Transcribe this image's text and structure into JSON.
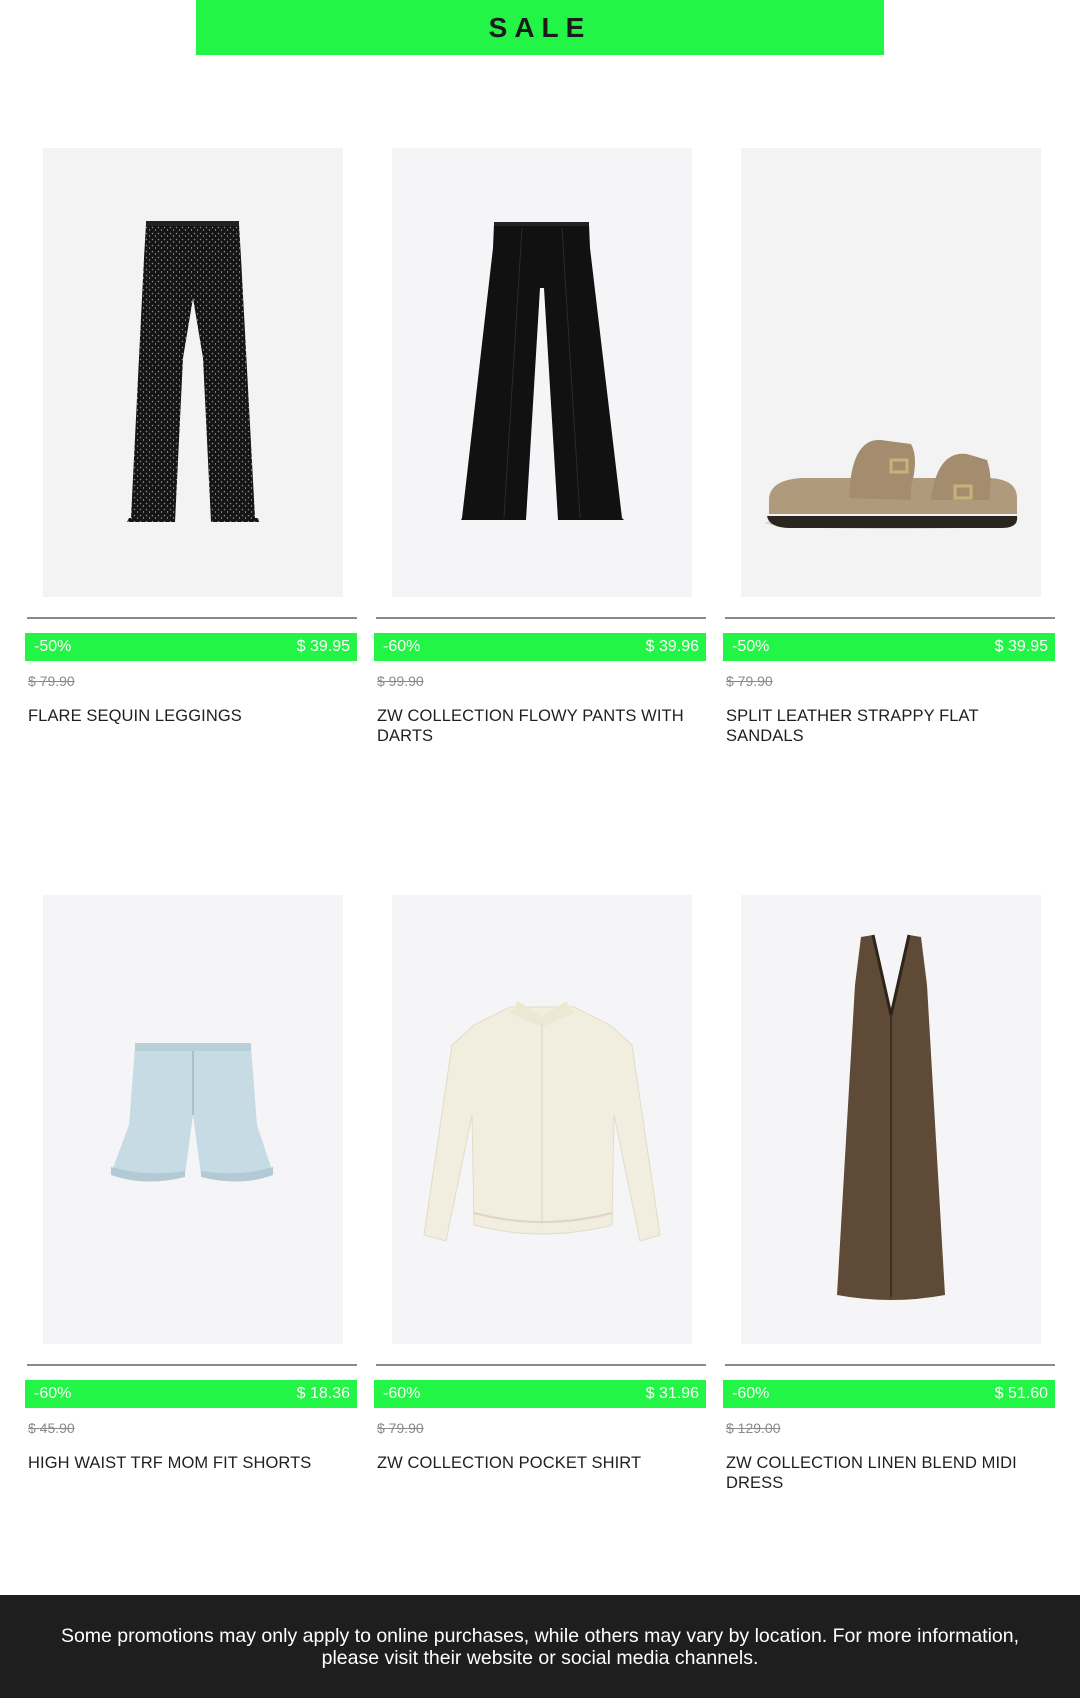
{
  "banner": {
    "title": "SALE"
  },
  "colors": {
    "accent": "#22f545",
    "footer_bg": "#1e1e1e"
  },
  "products": [
    {
      "discount": "-50%",
      "price": "$ 39.95",
      "original_price": "$ 79.90",
      "name": "FLARE SEQUIN LEGGINGS",
      "image_icon": "sequin-leggings-image"
    },
    {
      "discount": "-60%",
      "price": "$ 39.96",
      "original_price": "$ 99.90",
      "name": "ZW COLLECTION FLOWY PANTS WITH DARTS",
      "image_icon": "flowy-pants-image"
    },
    {
      "discount": "-50%",
      "price": "$ 39.95",
      "original_price": "$ 79.90",
      "name": "SPLIT LEATHER STRAPPY FLAT SANDALS",
      "image_icon": "sandals-image"
    },
    {
      "discount": "-60%",
      "price": "$ 18.36",
      "original_price": "$ 45.90",
      "name": "HIGH WAIST TRF MOM FIT SHORTS",
      "image_icon": "denim-shorts-image"
    },
    {
      "discount": "-60%",
      "price": "$ 31.96",
      "original_price": "$ 79.90",
      "name": "ZW COLLECTION POCKET SHIRT",
      "image_icon": "pocket-shirt-image"
    },
    {
      "discount": "-60%",
      "price": "$ 51.60",
      "original_price": "$ 129.00",
      "name": "ZW COLLECTION LINEN BLEND MIDI DRESS",
      "image_icon": "midi-dress-image"
    }
  ],
  "footer": {
    "text": "Some promotions may only apply to online purchases, while others may vary by location. For more information, please visit their website or social media channels."
  }
}
